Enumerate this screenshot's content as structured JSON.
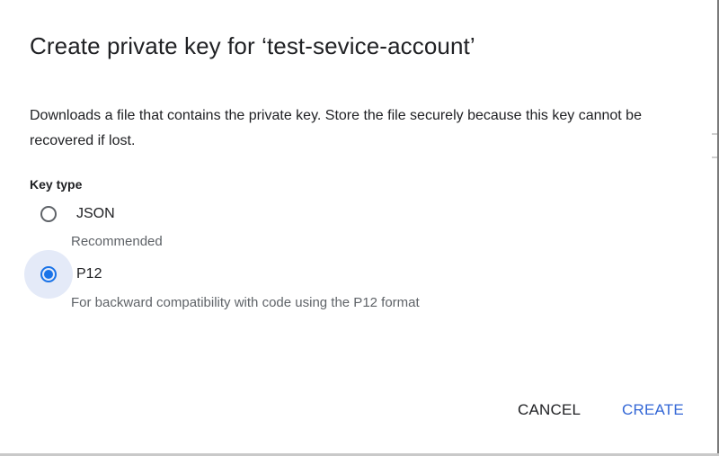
{
  "dialog": {
    "title": "Create private key for ‘test-sevice-account’",
    "description": "Downloads a file that contains the private key. Store the file securely because this key cannot be recovered if lost.",
    "key_type_label": "Key type",
    "options": [
      {
        "label": "JSON",
        "hint": "Recommended",
        "selected": false
      },
      {
        "label": "P12",
        "hint": "For backward compatibility with code using the P12 format",
        "selected": true
      }
    ],
    "actions": {
      "cancel_label": "CANCEL",
      "create_label": "CREATE"
    },
    "colors": {
      "accent": "#1a73e8",
      "create_text": "#3367d6",
      "focus_halo": "#e4eaf8",
      "hint_text": "#5f6368",
      "primary_text": "#202124"
    }
  }
}
